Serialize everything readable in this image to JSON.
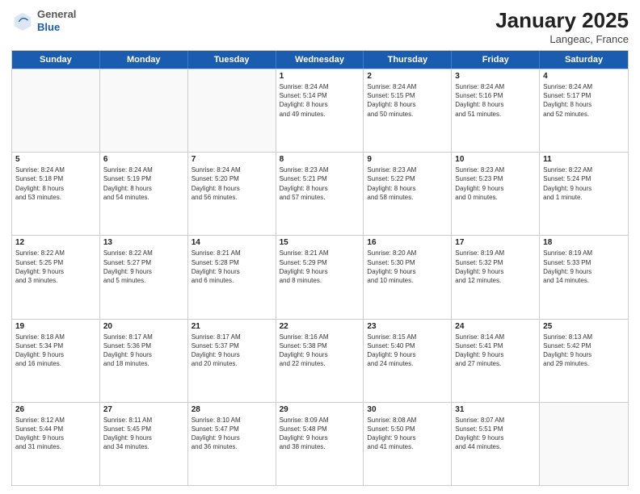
{
  "logo": {
    "general": "General",
    "blue": "Blue"
  },
  "header": {
    "month": "January 2025",
    "location": "Langeac, France"
  },
  "weekdays": [
    "Sunday",
    "Monday",
    "Tuesday",
    "Wednesday",
    "Thursday",
    "Friday",
    "Saturday"
  ],
  "weeks": [
    [
      {
        "day": "",
        "info": ""
      },
      {
        "day": "",
        "info": ""
      },
      {
        "day": "",
        "info": ""
      },
      {
        "day": "1",
        "info": "Sunrise: 8:24 AM\nSunset: 5:14 PM\nDaylight: 8 hours\nand 49 minutes."
      },
      {
        "day": "2",
        "info": "Sunrise: 8:24 AM\nSunset: 5:15 PM\nDaylight: 8 hours\nand 50 minutes."
      },
      {
        "day": "3",
        "info": "Sunrise: 8:24 AM\nSunset: 5:16 PM\nDaylight: 8 hours\nand 51 minutes."
      },
      {
        "day": "4",
        "info": "Sunrise: 8:24 AM\nSunset: 5:17 PM\nDaylight: 8 hours\nand 52 minutes."
      }
    ],
    [
      {
        "day": "5",
        "info": "Sunrise: 8:24 AM\nSunset: 5:18 PM\nDaylight: 8 hours\nand 53 minutes."
      },
      {
        "day": "6",
        "info": "Sunrise: 8:24 AM\nSunset: 5:19 PM\nDaylight: 8 hours\nand 54 minutes."
      },
      {
        "day": "7",
        "info": "Sunrise: 8:24 AM\nSunset: 5:20 PM\nDaylight: 8 hours\nand 56 minutes."
      },
      {
        "day": "8",
        "info": "Sunrise: 8:23 AM\nSunset: 5:21 PM\nDaylight: 8 hours\nand 57 minutes."
      },
      {
        "day": "9",
        "info": "Sunrise: 8:23 AM\nSunset: 5:22 PM\nDaylight: 8 hours\nand 58 minutes."
      },
      {
        "day": "10",
        "info": "Sunrise: 8:23 AM\nSunset: 5:23 PM\nDaylight: 9 hours\nand 0 minutes."
      },
      {
        "day": "11",
        "info": "Sunrise: 8:22 AM\nSunset: 5:24 PM\nDaylight: 9 hours\nand 1 minute."
      }
    ],
    [
      {
        "day": "12",
        "info": "Sunrise: 8:22 AM\nSunset: 5:25 PM\nDaylight: 9 hours\nand 3 minutes."
      },
      {
        "day": "13",
        "info": "Sunrise: 8:22 AM\nSunset: 5:27 PM\nDaylight: 9 hours\nand 5 minutes."
      },
      {
        "day": "14",
        "info": "Sunrise: 8:21 AM\nSunset: 5:28 PM\nDaylight: 9 hours\nand 6 minutes."
      },
      {
        "day": "15",
        "info": "Sunrise: 8:21 AM\nSunset: 5:29 PM\nDaylight: 9 hours\nand 8 minutes."
      },
      {
        "day": "16",
        "info": "Sunrise: 8:20 AM\nSunset: 5:30 PM\nDaylight: 9 hours\nand 10 minutes."
      },
      {
        "day": "17",
        "info": "Sunrise: 8:19 AM\nSunset: 5:32 PM\nDaylight: 9 hours\nand 12 minutes."
      },
      {
        "day": "18",
        "info": "Sunrise: 8:19 AM\nSunset: 5:33 PM\nDaylight: 9 hours\nand 14 minutes."
      }
    ],
    [
      {
        "day": "19",
        "info": "Sunrise: 8:18 AM\nSunset: 5:34 PM\nDaylight: 9 hours\nand 16 minutes."
      },
      {
        "day": "20",
        "info": "Sunrise: 8:17 AM\nSunset: 5:36 PM\nDaylight: 9 hours\nand 18 minutes."
      },
      {
        "day": "21",
        "info": "Sunrise: 8:17 AM\nSunset: 5:37 PM\nDaylight: 9 hours\nand 20 minutes."
      },
      {
        "day": "22",
        "info": "Sunrise: 8:16 AM\nSunset: 5:38 PM\nDaylight: 9 hours\nand 22 minutes."
      },
      {
        "day": "23",
        "info": "Sunrise: 8:15 AM\nSunset: 5:40 PM\nDaylight: 9 hours\nand 24 minutes."
      },
      {
        "day": "24",
        "info": "Sunrise: 8:14 AM\nSunset: 5:41 PM\nDaylight: 9 hours\nand 27 minutes."
      },
      {
        "day": "25",
        "info": "Sunrise: 8:13 AM\nSunset: 5:42 PM\nDaylight: 9 hours\nand 29 minutes."
      }
    ],
    [
      {
        "day": "26",
        "info": "Sunrise: 8:12 AM\nSunset: 5:44 PM\nDaylight: 9 hours\nand 31 minutes."
      },
      {
        "day": "27",
        "info": "Sunrise: 8:11 AM\nSunset: 5:45 PM\nDaylight: 9 hours\nand 34 minutes."
      },
      {
        "day": "28",
        "info": "Sunrise: 8:10 AM\nSunset: 5:47 PM\nDaylight: 9 hours\nand 36 minutes."
      },
      {
        "day": "29",
        "info": "Sunrise: 8:09 AM\nSunset: 5:48 PM\nDaylight: 9 hours\nand 38 minutes."
      },
      {
        "day": "30",
        "info": "Sunrise: 8:08 AM\nSunset: 5:50 PM\nDaylight: 9 hours\nand 41 minutes."
      },
      {
        "day": "31",
        "info": "Sunrise: 8:07 AM\nSunset: 5:51 PM\nDaylight: 9 hours\nand 44 minutes."
      },
      {
        "day": "",
        "info": ""
      }
    ]
  ]
}
